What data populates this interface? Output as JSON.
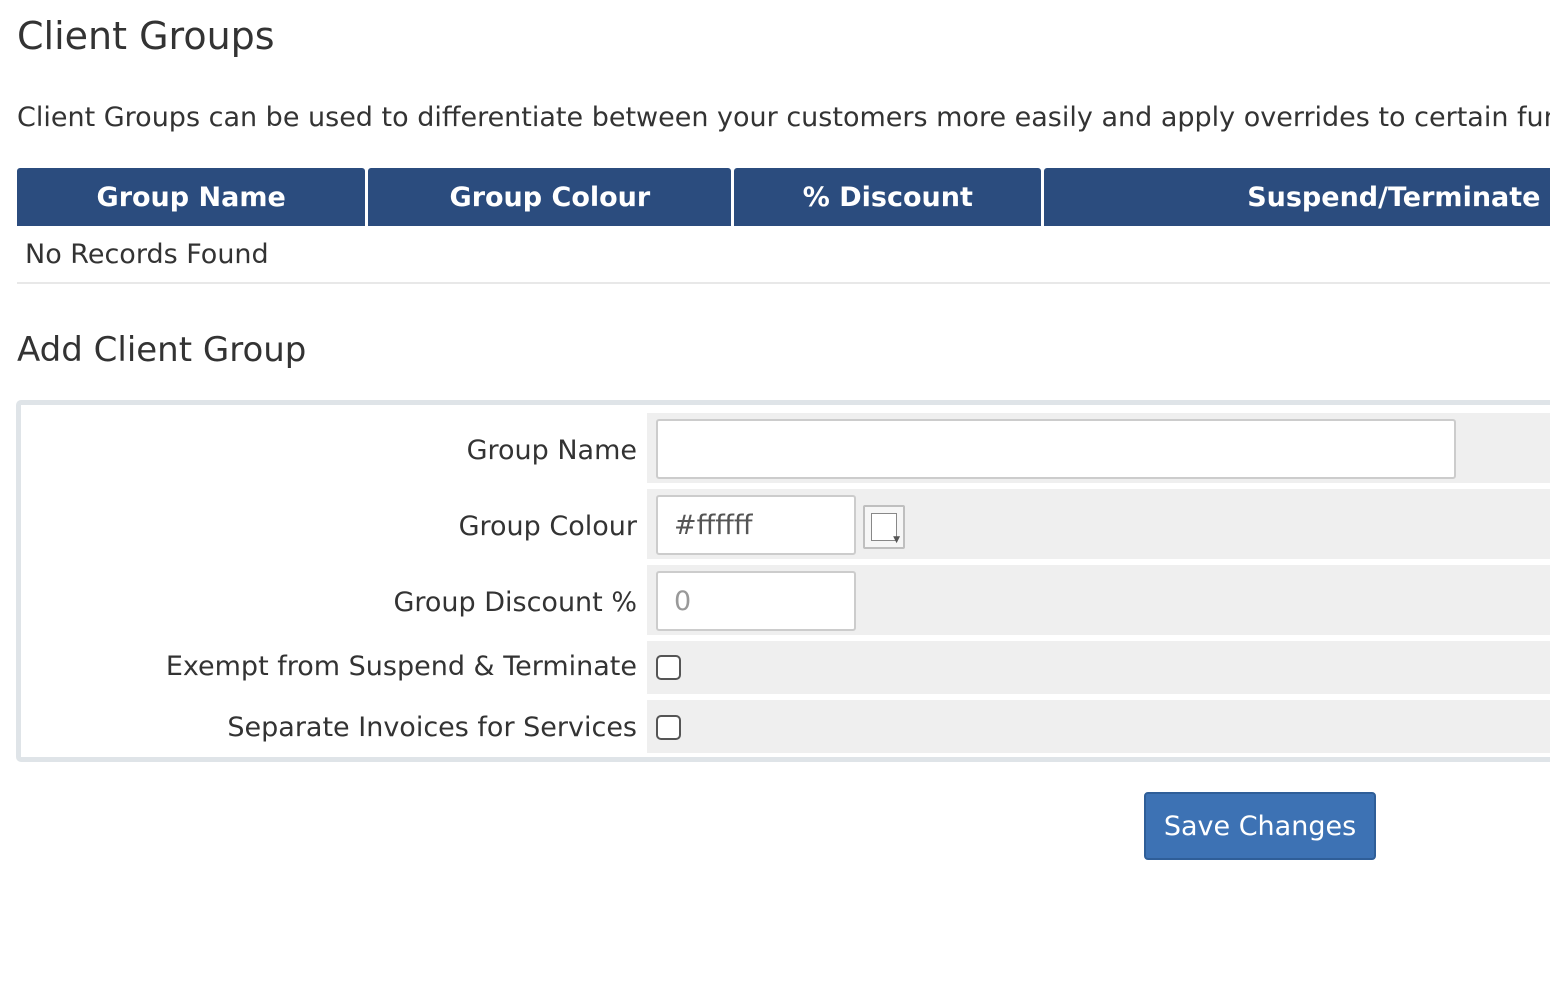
{
  "page": {
    "title": "Client Groups",
    "intro": "Client Groups can be used to differentiate between your customers more easily and apply overrides to certain functions"
  },
  "table": {
    "columns": [
      "Group Name",
      "Group Colour",
      "% Discount",
      "Suspend/Terminate"
    ],
    "empty_message": "No Records Found"
  },
  "add_form": {
    "title": "Add Client Group",
    "group_name": {
      "label": "Group Name",
      "value": ""
    },
    "group_colour": {
      "label": "Group Colour",
      "value": "#ffffff",
      "swatch_color": "#ffffff"
    },
    "group_discount": {
      "label": "Group Discount %",
      "placeholder": "0"
    },
    "exempt": {
      "label": "Exempt from Suspend & Terminate",
      "checked": false
    },
    "separate_invoices": {
      "label": "Separate Invoices for Services",
      "checked": false
    },
    "save_label": "Save Changes"
  },
  "colors": {
    "header_bg": "#2b4c7e",
    "button_bg": "#3d72b4"
  }
}
